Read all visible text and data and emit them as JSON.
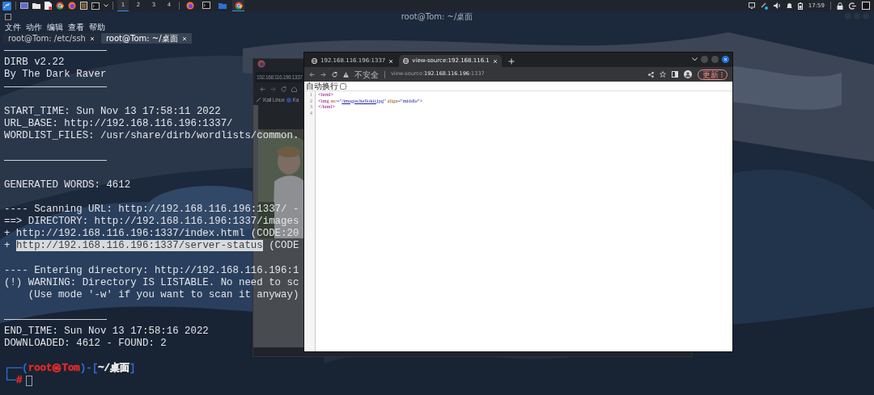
{
  "taskbar": {
    "workspaces": [
      {
        "label": "1",
        "selected": true
      },
      {
        "label": "2",
        "selected": false
      },
      {
        "label": "3",
        "selected": false
      },
      {
        "label": "4",
        "selected": false
      }
    ],
    "tasks": [
      {
        "kind": "firefox",
        "selected": false
      },
      {
        "kind": "terminal",
        "selected": false
      },
      {
        "kind": "folder",
        "selected": false
      },
      {
        "kind": "chrome",
        "selected": true
      }
    ],
    "clock": "17:59"
  },
  "terminal": {
    "title": "root@Tom: ~/桌面",
    "menu": [
      "文件",
      "动作",
      "编辑",
      "查看",
      "帮助"
    ],
    "tabs": [
      {
        "label": "root@Tom: /etc/ssh",
        "selected": false
      },
      {
        "label": "root@Tom: ~/桌面",
        "selected": true
      }
    ],
    "lines": [
      {
        "kind": "rule"
      },
      {
        "kind": "text",
        "text": "DIRB v2.22"
      },
      {
        "kind": "text",
        "text": "By The Dark Raver"
      },
      {
        "kind": "rule"
      },
      {
        "kind": "blank"
      },
      {
        "kind": "text",
        "text": "START_TIME: Sun Nov 13 17:58:11 2022"
      },
      {
        "kind": "text",
        "text": "URL_BASE: http://192.168.116.196:1337/"
      },
      {
        "kind": "text",
        "text": "WORDLIST_FILES: /usr/share/dirb/wordlists/common."
      },
      {
        "kind": "blank"
      },
      {
        "kind": "rule"
      },
      {
        "kind": "blank"
      },
      {
        "kind": "text",
        "text": "GENERATED WORDS: 4612"
      },
      {
        "kind": "blank"
      },
      {
        "kind": "text",
        "text": "---- Scanning URL: http://192.168.116.196:1337/ -"
      },
      {
        "kind": "text",
        "text": "==> DIRECTORY: http://192.168.116.196:1337/images"
      },
      {
        "kind": "text",
        "text": "+ http://192.168.116.196:1337/index.html (CODE:20"
      },
      {
        "kind": "parts",
        "parts": [
          {
            "text": "+ ",
            "selected": false
          },
          {
            "text": "http://192.168.116.196:1337/server-status",
            "selected": true
          },
          {
            "text": " (CODE",
            "selected": false
          }
        ]
      },
      {
        "kind": "blank"
      },
      {
        "kind": "text",
        "text": "---- Entering directory: http://192.168.116.196:1"
      },
      {
        "kind": "text",
        "text": "(!) WARNING: Directory IS LISTABLE. No need to sc"
      },
      {
        "kind": "text",
        "text": "    (Use mode '-w' if you want to scan it anyway)"
      },
      {
        "kind": "blank"
      },
      {
        "kind": "rule"
      },
      {
        "kind": "text",
        "text": "END_TIME: Sun Nov 13 17:58:16 2022"
      },
      {
        "kind": "text",
        "text": "DOWNLOADED: 4612 - FOUND: 2"
      },
      {
        "kind": "blank"
      },
      {
        "kind": "prompt",
        "parts": [
          {
            "text": "┌──(",
            "color": "#2f6fd0",
            "bold": false
          },
          {
            "text": "root㉿Tom",
            "color": "#e02a2a",
            "bold": true
          },
          {
            "text": ")-[",
            "color": "#2f6fd0",
            "bold": false
          },
          {
            "text": "~/桌面",
            "color": "#e8e8e8",
            "bold": true
          },
          {
            "text": "]",
            "color": "#2f6fd0",
            "bold": false
          }
        ]
      },
      {
        "kind": "input",
        "parts": [
          {
            "text": "└─",
            "color": "#2f6fd0"
          },
          {
            "text": "#",
            "color": "#e02a2a",
            "bold": true
          }
        ]
      }
    ]
  },
  "firefox_window": {
    "address": "192.168.116.196:1337",
    "bookmarks": [
      "Kali Linux",
      "Ka"
    ]
  },
  "chrome_window": {
    "tabs": [
      {
        "label": "192.168.116.196:1337",
        "selected": false
      },
      {
        "label": "view-source:192.168.116.1",
        "selected": true
      }
    ],
    "security": "不安全",
    "address": {
      "scheme": "view-source:",
      "host": "192.168.116.196",
      "port": ":1337"
    },
    "update_button": "更新",
    "wrap_option": {
      "label": "自动换行",
      "checked": false
    },
    "code_lines": [
      {
        "number": "1",
        "parts": [
          {
            "kind": "tag",
            "text": "<html>"
          }
        ]
      },
      {
        "number": "2",
        "parts": [
          {
            "kind": "tag",
            "text": "<img "
          },
          {
            "kind": "attr",
            "text": "src"
          },
          {
            "kind": "value",
            "text": "=\""
          },
          {
            "kind": "link",
            "text": "/images/hellokit.jpg"
          },
          {
            "kind": "value",
            "text": "\" "
          },
          {
            "kind": "attr",
            "text": "align"
          },
          {
            "kind": "value",
            "text": "=\"middle\""
          },
          {
            "kind": "tag",
            "text": ">"
          }
        ]
      },
      {
        "number": "3",
        "parts": [
          {
            "kind": "tag",
            "text": "</html>"
          }
        ]
      },
      {
        "number": "4"
      }
    ]
  }
}
